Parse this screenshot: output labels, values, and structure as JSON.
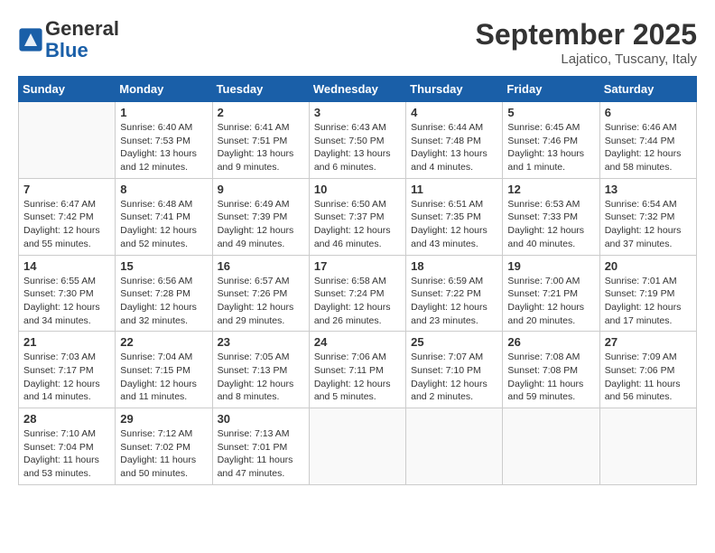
{
  "header": {
    "logo_general": "General",
    "logo_blue": "Blue",
    "month_title": "September 2025",
    "location": "Lajatico, Tuscany, Italy"
  },
  "weekdays": [
    "Sunday",
    "Monday",
    "Tuesday",
    "Wednesday",
    "Thursday",
    "Friday",
    "Saturday"
  ],
  "weeks": [
    [
      {
        "day": "",
        "info": ""
      },
      {
        "day": "1",
        "info": "Sunrise: 6:40 AM\nSunset: 7:53 PM\nDaylight: 13 hours\nand 12 minutes."
      },
      {
        "day": "2",
        "info": "Sunrise: 6:41 AM\nSunset: 7:51 PM\nDaylight: 13 hours\nand 9 minutes."
      },
      {
        "day": "3",
        "info": "Sunrise: 6:43 AM\nSunset: 7:50 PM\nDaylight: 13 hours\nand 6 minutes."
      },
      {
        "day": "4",
        "info": "Sunrise: 6:44 AM\nSunset: 7:48 PM\nDaylight: 13 hours\nand 4 minutes."
      },
      {
        "day": "5",
        "info": "Sunrise: 6:45 AM\nSunset: 7:46 PM\nDaylight: 13 hours\nand 1 minute."
      },
      {
        "day": "6",
        "info": "Sunrise: 6:46 AM\nSunset: 7:44 PM\nDaylight: 12 hours\nand 58 minutes."
      }
    ],
    [
      {
        "day": "7",
        "info": "Sunrise: 6:47 AM\nSunset: 7:42 PM\nDaylight: 12 hours\nand 55 minutes."
      },
      {
        "day": "8",
        "info": "Sunrise: 6:48 AM\nSunset: 7:41 PM\nDaylight: 12 hours\nand 52 minutes."
      },
      {
        "day": "9",
        "info": "Sunrise: 6:49 AM\nSunset: 7:39 PM\nDaylight: 12 hours\nand 49 minutes."
      },
      {
        "day": "10",
        "info": "Sunrise: 6:50 AM\nSunset: 7:37 PM\nDaylight: 12 hours\nand 46 minutes."
      },
      {
        "day": "11",
        "info": "Sunrise: 6:51 AM\nSunset: 7:35 PM\nDaylight: 12 hours\nand 43 minutes."
      },
      {
        "day": "12",
        "info": "Sunrise: 6:53 AM\nSunset: 7:33 PM\nDaylight: 12 hours\nand 40 minutes."
      },
      {
        "day": "13",
        "info": "Sunrise: 6:54 AM\nSunset: 7:32 PM\nDaylight: 12 hours\nand 37 minutes."
      }
    ],
    [
      {
        "day": "14",
        "info": "Sunrise: 6:55 AM\nSunset: 7:30 PM\nDaylight: 12 hours\nand 34 minutes."
      },
      {
        "day": "15",
        "info": "Sunrise: 6:56 AM\nSunset: 7:28 PM\nDaylight: 12 hours\nand 32 minutes."
      },
      {
        "day": "16",
        "info": "Sunrise: 6:57 AM\nSunset: 7:26 PM\nDaylight: 12 hours\nand 29 minutes."
      },
      {
        "day": "17",
        "info": "Sunrise: 6:58 AM\nSunset: 7:24 PM\nDaylight: 12 hours\nand 26 minutes."
      },
      {
        "day": "18",
        "info": "Sunrise: 6:59 AM\nSunset: 7:22 PM\nDaylight: 12 hours\nand 23 minutes."
      },
      {
        "day": "19",
        "info": "Sunrise: 7:00 AM\nSunset: 7:21 PM\nDaylight: 12 hours\nand 20 minutes."
      },
      {
        "day": "20",
        "info": "Sunrise: 7:01 AM\nSunset: 7:19 PM\nDaylight: 12 hours\nand 17 minutes."
      }
    ],
    [
      {
        "day": "21",
        "info": "Sunrise: 7:03 AM\nSunset: 7:17 PM\nDaylight: 12 hours\nand 14 minutes."
      },
      {
        "day": "22",
        "info": "Sunrise: 7:04 AM\nSunset: 7:15 PM\nDaylight: 12 hours\nand 11 minutes."
      },
      {
        "day": "23",
        "info": "Sunrise: 7:05 AM\nSunset: 7:13 PM\nDaylight: 12 hours\nand 8 minutes."
      },
      {
        "day": "24",
        "info": "Sunrise: 7:06 AM\nSunset: 7:11 PM\nDaylight: 12 hours\nand 5 minutes."
      },
      {
        "day": "25",
        "info": "Sunrise: 7:07 AM\nSunset: 7:10 PM\nDaylight: 12 hours\nand 2 minutes."
      },
      {
        "day": "26",
        "info": "Sunrise: 7:08 AM\nSunset: 7:08 PM\nDaylight: 11 hours\nand 59 minutes."
      },
      {
        "day": "27",
        "info": "Sunrise: 7:09 AM\nSunset: 7:06 PM\nDaylight: 11 hours\nand 56 minutes."
      }
    ],
    [
      {
        "day": "28",
        "info": "Sunrise: 7:10 AM\nSunset: 7:04 PM\nDaylight: 11 hours\nand 53 minutes."
      },
      {
        "day": "29",
        "info": "Sunrise: 7:12 AM\nSunset: 7:02 PM\nDaylight: 11 hours\nand 50 minutes."
      },
      {
        "day": "30",
        "info": "Sunrise: 7:13 AM\nSunset: 7:01 PM\nDaylight: 11 hours\nand 47 minutes."
      },
      {
        "day": "",
        "info": ""
      },
      {
        "day": "",
        "info": ""
      },
      {
        "day": "",
        "info": ""
      },
      {
        "day": "",
        "info": ""
      }
    ]
  ]
}
